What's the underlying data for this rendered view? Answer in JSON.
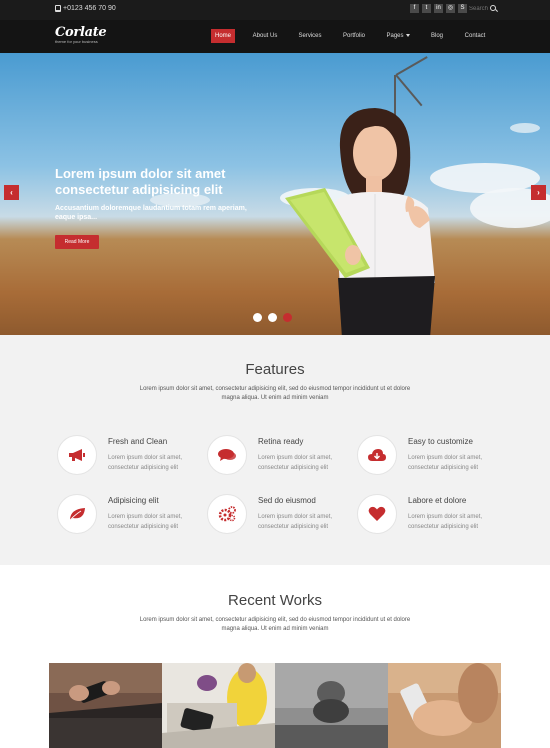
{
  "topbar": {
    "phone": "+0123 456 70 90",
    "socials": [
      "facebook-icon",
      "twitter-icon",
      "linkedin-icon",
      "dribbble-icon",
      "skype-icon"
    ],
    "social_glyphs": [
      "f",
      "t",
      "in",
      "◎",
      "S"
    ],
    "search_placeholder": "Search"
  },
  "logo": {
    "brand": "Corlate",
    "tagline": "theme for your business"
  },
  "nav": {
    "items": [
      "Home",
      "About Us",
      "Services",
      "Portfolio",
      "Pages",
      "Blog",
      "Contact"
    ],
    "active": "Home"
  },
  "hero": {
    "title": "Lorem ipsum dolor sit amet consectetur adipisicing elit",
    "subtitle": "Accusantium doloremque laudantium totam rem aperiam, eaque ipsa...",
    "button": "Read More",
    "prev": "‹",
    "next": "›",
    "active_slide": 3
  },
  "features": {
    "title": "Features",
    "description": "Lorem ipsum dolor sit amet, consectetur adipisicing elit, sed do eiusmod tempor incididunt ut et dolore magna aliqua. Ut enim ad minim veniam",
    "items": [
      {
        "title": "Fresh and Clean",
        "text": "Lorem ipsum dolor sit amet, consectetur adipisicing elit",
        "icon": "bullhorn-icon"
      },
      {
        "title": "Retina ready",
        "text": "Lorem ipsum dolor sit amet, consectetur adipisicing elit",
        "icon": "comments-icon"
      },
      {
        "title": "Easy to customize",
        "text": "Lorem ipsum dolor sit amet, consectetur adipisicing elit",
        "icon": "cloud-download-icon"
      },
      {
        "title": "Adipisicing elit",
        "text": "Lorem ipsum dolor sit amet, consectetur adipisicing elit",
        "icon": "leaf-icon"
      },
      {
        "title": "Sed do eiusmod",
        "text": "Lorem ipsum dolor sit amet, consectetur adipisicing elit",
        "icon": "cogs-icon"
      },
      {
        "title": "Labore et dolore",
        "text": "Lorem ipsum dolor sit amet, consectetur adipisicing elit",
        "icon": "heart-icon"
      }
    ]
  },
  "works": {
    "title": "Recent Works",
    "description": "Lorem ipsum dolor sit amet, consectetur adipisicing elit, sed do eiusmod tempor incididunt ut et dolore magna aliqua. Ut enim ad minim veniam"
  },
  "colors": {
    "accent": "#c52d2f",
    "topbar": "#1b1b1b",
    "navbar": "#141414",
    "features_bg": "#f2f2f2"
  }
}
